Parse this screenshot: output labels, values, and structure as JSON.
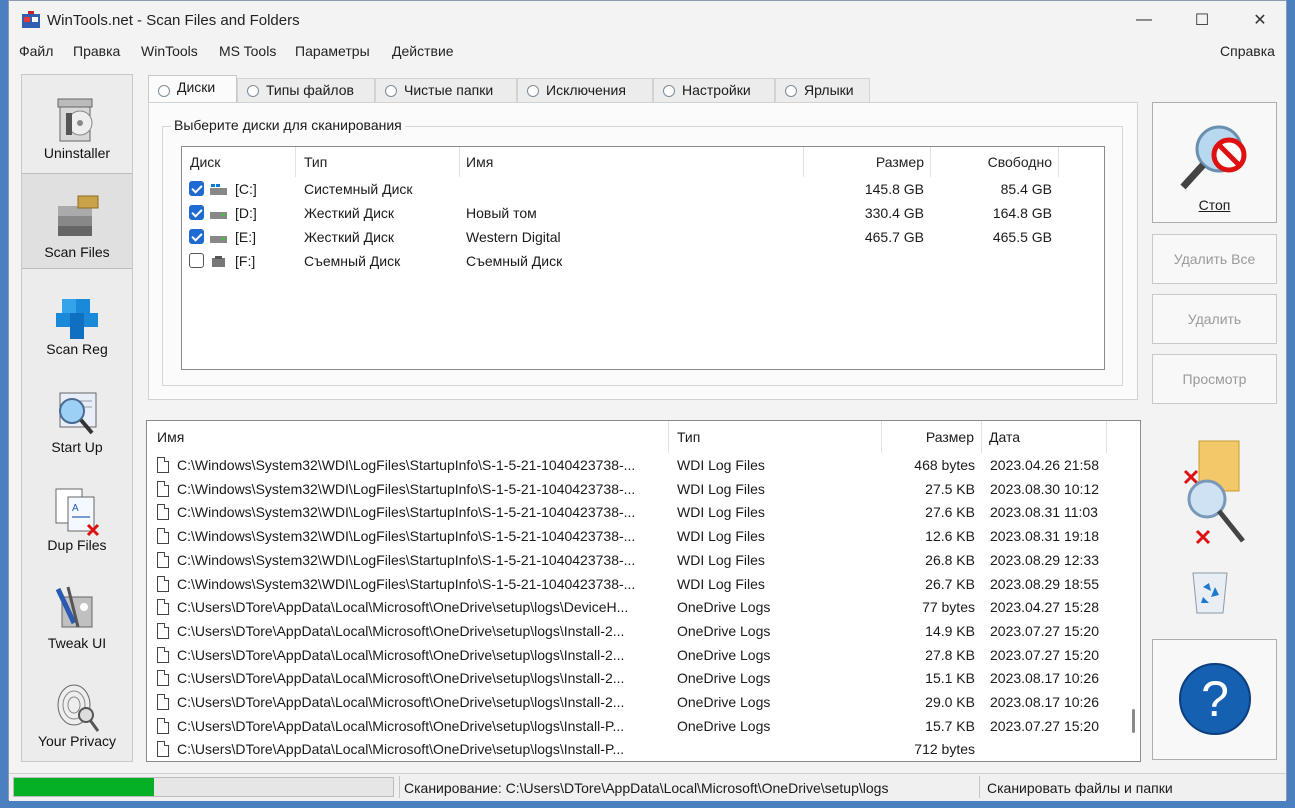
{
  "window": {
    "title": "WinTools.net - Scan Files and Folders",
    "controls": {
      "minimize": "—",
      "maximize": "☐",
      "close": "✕"
    }
  },
  "menu": [
    "Файл",
    "Правка",
    "WinTools",
    "MS Tools",
    "Параметры",
    "Действие"
  ],
  "menu_help": "Справка",
  "sidebar": [
    {
      "label": "Uninstaller",
      "icon": "uninstaller-icon"
    },
    {
      "label": "Scan Files",
      "icon": "scan-files-icon",
      "active": true
    },
    {
      "label": "Scan Reg",
      "icon": "scan-reg-icon"
    },
    {
      "label": "Start Up",
      "icon": "startup-icon"
    },
    {
      "label": "Dup Files",
      "icon": "dup-files-icon"
    },
    {
      "label": "Tweak UI",
      "icon": "tweak-ui-icon"
    },
    {
      "label": "Your Privacy",
      "icon": "privacy-icon"
    }
  ],
  "tabs": [
    "Диски",
    "Типы файлов",
    "Чистые папки",
    "Исключения",
    "Настройки",
    "Ярлыки"
  ],
  "disks": {
    "group_title": "Выберите диски для сканирования",
    "columns": [
      "Диск",
      "Тип",
      "Имя",
      "Размер",
      "Свободно"
    ],
    "rows": [
      {
        "checked": true,
        "drive": "[C:]",
        "type": "Системный Диск",
        "name": "",
        "size": "145.8 GB",
        "free": "85.4 GB"
      },
      {
        "checked": true,
        "drive": "[D:]",
        "type": "Жесткий Диск",
        "name": "Новый том",
        "size": "330.4 GB",
        "free": "164.8 GB"
      },
      {
        "checked": true,
        "drive": "[E:]",
        "type": "Жесткий Диск",
        "name": "Western Digital",
        "size": "465.7 GB",
        "free": "465.5 GB"
      },
      {
        "checked": false,
        "drive": "[F:]",
        "type": "Съемный Диск",
        "name": "Съемный Диск",
        "size": "",
        "free": ""
      }
    ]
  },
  "buttons": {
    "stop": "Стоп",
    "delete_all": "Удалить Все",
    "delete": "Удалить",
    "view": "Просмотр"
  },
  "files": {
    "columns": [
      "Имя",
      "Тип",
      "Размер",
      "Дата"
    ],
    "rows": [
      {
        "name": "C:\\Windows\\System32\\WDI\\LogFiles\\StartupInfo\\S-1-5-21-1040423738-...",
        "type": "WDI Log Files",
        "size": "468 bytes",
        "date": "2023.04.26 21:58"
      },
      {
        "name": "C:\\Windows\\System32\\WDI\\LogFiles\\StartupInfo\\S-1-5-21-1040423738-...",
        "type": "WDI Log Files",
        "size": "27.5 KB",
        "date": "2023.08.30 10:12"
      },
      {
        "name": "C:\\Windows\\System32\\WDI\\LogFiles\\StartupInfo\\S-1-5-21-1040423738-...",
        "type": "WDI Log Files",
        "size": "27.6 KB",
        "date": "2023.08.31 11:03"
      },
      {
        "name": "C:\\Windows\\System32\\WDI\\LogFiles\\StartupInfo\\S-1-5-21-1040423738-...",
        "type": "WDI Log Files",
        "size": "12.6 KB",
        "date": "2023.08.31 19:18"
      },
      {
        "name": "C:\\Windows\\System32\\WDI\\LogFiles\\StartupInfo\\S-1-5-21-1040423738-...",
        "type": "WDI Log Files",
        "size": "26.8 KB",
        "date": "2023.08.29 12:33"
      },
      {
        "name": "C:\\Windows\\System32\\WDI\\LogFiles\\StartupInfo\\S-1-5-21-1040423738-...",
        "type": "WDI Log Files",
        "size": "26.7 KB",
        "date": "2023.08.29 18:55"
      },
      {
        "name": "C:\\Users\\DTore\\AppData\\Local\\Microsoft\\OneDrive\\setup\\logs\\DeviceH...",
        "type": "OneDrive Logs",
        "size": "77 bytes",
        "date": "2023.04.27 15:28"
      },
      {
        "name": "C:\\Users\\DTore\\AppData\\Local\\Microsoft\\OneDrive\\setup\\logs\\Install-2...",
        "type": "OneDrive Logs",
        "size": "14.9 KB",
        "date": "2023.07.27 15:20"
      },
      {
        "name": "C:\\Users\\DTore\\AppData\\Local\\Microsoft\\OneDrive\\setup\\logs\\Install-2...",
        "type": "OneDrive Logs",
        "size": "27.8 KB",
        "date": "2023.07.27 15:20"
      },
      {
        "name": "C:\\Users\\DTore\\AppData\\Local\\Microsoft\\OneDrive\\setup\\logs\\Install-2...",
        "type": "OneDrive Logs",
        "size": "15.1 KB",
        "date": "2023.08.17 10:26"
      },
      {
        "name": "C:\\Users\\DTore\\AppData\\Local\\Microsoft\\OneDrive\\setup\\logs\\Install-2...",
        "type": "OneDrive Logs",
        "size": "29.0 KB",
        "date": "2023.08.17 10:26"
      },
      {
        "name": "C:\\Users\\DTore\\AppData\\Local\\Microsoft\\OneDrive\\setup\\logs\\Install-P...",
        "type": "OneDrive Logs",
        "size": "15.7 KB",
        "date": "2023.07.27 15:20"
      },
      {
        "name": "C:\\Users\\DTore\\AppData\\Local\\Microsoft\\OneDrive\\setup\\logs\\Install-P...",
        "type": "",
        "size": "712 bytes",
        "date": ""
      }
    ]
  },
  "status": {
    "progress": 0.37,
    "scanning": "Сканирование: C:\\Users\\DTore\\AppData\\Local\\Microsoft\\OneDrive\\setup\\logs",
    "action": "Сканировать файлы и папки"
  },
  "colors": {
    "accent": "#1e6ad0",
    "progress": "#06b025",
    "help": "#1560b0"
  }
}
